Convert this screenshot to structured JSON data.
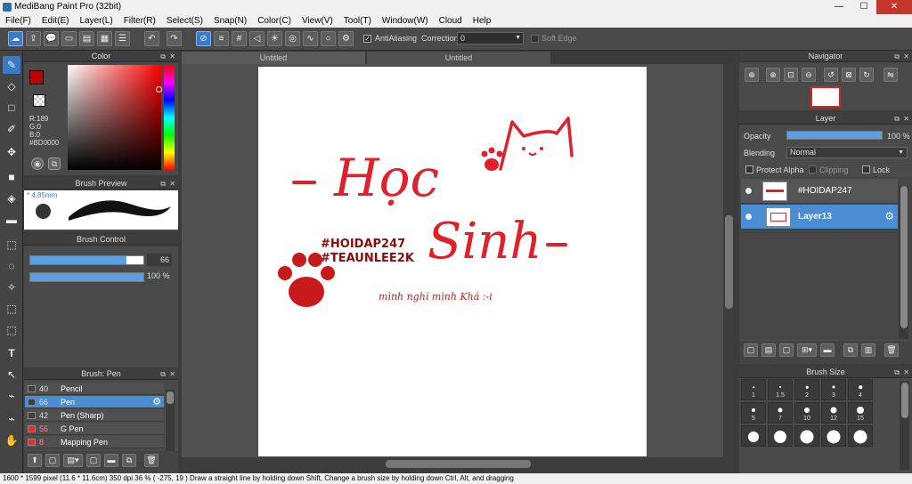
{
  "window": {
    "title": "MediBang Paint Pro (32bit)"
  },
  "menu": [
    "File(F)",
    "Edit(E)",
    "Layer(L)",
    "Filter(R)",
    "Select(S)",
    "Snap(N)",
    "Color(C)",
    "View(V)",
    "Tool(T)",
    "Window(W)",
    "Cloud",
    "Help"
  ],
  "toolbar": {
    "antialias_label": "AntiAliasing",
    "correction_label": "Correction",
    "correction_value": "0",
    "soft_edge_label": "Soft Edge"
  },
  "color_panel": {
    "title": "Color",
    "r": "R:189",
    "g": "G:0",
    "b": "B:0",
    "hex": "#BD0000",
    "primary_color": "#bd0000"
  },
  "brush_preview": {
    "title": "Brush Preview",
    "size": "4.85mm"
  },
  "brush_control": {
    "title": "Brush Control",
    "size_value": "66",
    "opacity_value": "100 %",
    "size_fraction": 0.85,
    "opacity_fraction": 1.0
  },
  "brush_list": {
    "title": "Brush: Pen",
    "items": [
      {
        "size": "40",
        "name": "Pencil",
        "color": "#404040"
      },
      {
        "size": "66",
        "name": "Pen",
        "color": "#404040"
      },
      {
        "size": "42",
        "name": "Pen (Sharp)",
        "color": "#404040"
      },
      {
        "size": "55",
        "name": "G Pen",
        "color": "#e03030"
      },
      {
        "size": "8",
        "name": "Mapping Pen",
        "color": "#e03030"
      }
    ]
  },
  "tabs": [
    "Untitled",
    "Untitled"
  ],
  "artwork": {
    "title_word_1": "Học",
    "title_word_2": "Sinh",
    "tag_1": "#HOIDAP247",
    "tag_2": "#TEAUNLEE2K",
    "caption": "mình nghĩ mình Khá :-i"
  },
  "navigator": {
    "title": "Navigator"
  },
  "layer_panel": {
    "title": "Layer",
    "opacity_label": "Opacity",
    "opacity_value": "100 %",
    "opacity_fraction": 1.0,
    "blending_label": "Blending",
    "blending_value": "Normal",
    "protect_alpha_label": "Protect Alpha",
    "clipping_label": "Clipping",
    "lock_label": "Lock",
    "layers": [
      {
        "name": "#HOIDAP247"
      },
      {
        "name": "Layer13"
      }
    ]
  },
  "brush_size": {
    "title": "Brush Size",
    "sizes": [
      "1",
      "1.5",
      "2",
      "3",
      "4",
      "5",
      "7",
      "10",
      "12",
      "15",
      "",
      "",
      "",
      "",
      ""
    ]
  },
  "status": {
    "text": "1600 * 1599 pixel   (11.6 * 11.6cm)   350 dpi   36 %   ( -275, 19 )   Draw a straight line by holding down Shift, Change a brush size by holding down Ctrl, Alt, and dragging"
  }
}
